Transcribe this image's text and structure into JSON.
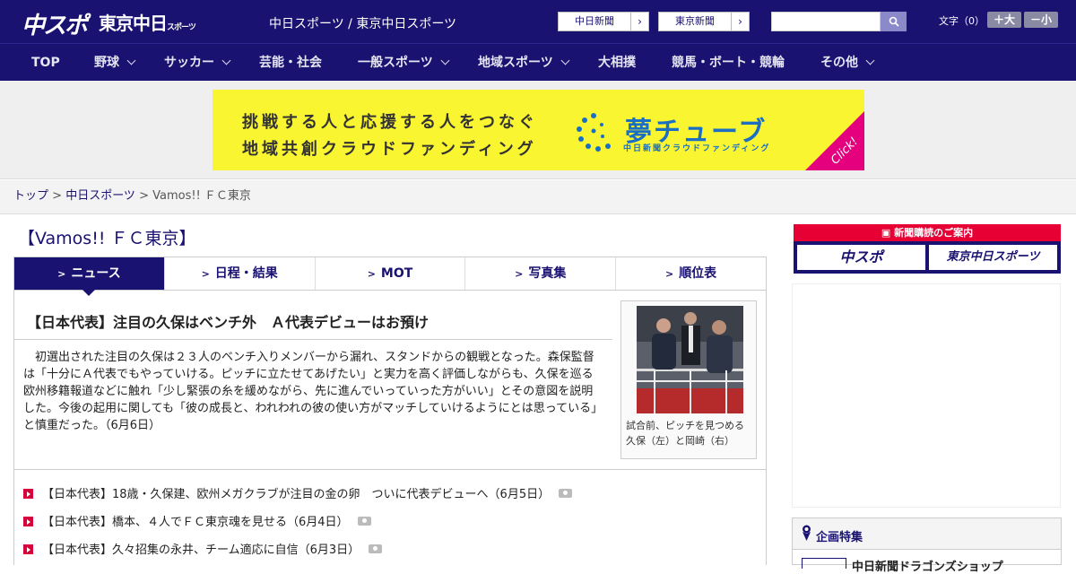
{
  "header": {
    "logo_chuspo": "中スポ",
    "logo_tokyo": "東京中日",
    "logo_tokyo_small": "スポーツ",
    "site_sub": "中日スポーツ / 東京中日スポーツ",
    "paper_buttons": [
      {
        "label": "中日新聞",
        "arrow": "›"
      },
      {
        "label": "東京新聞",
        "arrow": "›"
      }
    ],
    "search_placeholder": "",
    "text_size_label": "文字（0）",
    "text_size_up": "＋大",
    "text_size_down": "－小"
  },
  "nav": {
    "items": [
      {
        "label": "TOP",
        "has_dropdown": false
      },
      {
        "label": "野球",
        "has_dropdown": true
      },
      {
        "label": "サッカー",
        "has_dropdown": true
      },
      {
        "label": "芸能・社会",
        "has_dropdown": false
      },
      {
        "label": "一般スポーツ",
        "has_dropdown": true
      },
      {
        "label": "地域スポーツ",
        "has_dropdown": true
      },
      {
        "label": "大相撲",
        "has_dropdown": false
      },
      {
        "label": "競馬・ボート・競輪",
        "has_dropdown": false
      },
      {
        "label": "その他",
        "has_dropdown": true
      }
    ]
  },
  "banner": {
    "line1": "挑戦する人と応援する人をつなぐ",
    "line2": "地域共創クラウドファンディング",
    "brand": "夢チューブ",
    "brand_sub": "中日新聞クラウドファンディング",
    "click": "Click!",
    "colors": {
      "background": "#faf531",
      "brand": "#1a6fc4",
      "corner": "#e5007e"
    }
  },
  "breadcrumb": {
    "items": [
      "トップ",
      "中日スポーツ",
      "Vamos!! ＦＣ東京"
    ],
    "separator": " > "
  },
  "page": {
    "heading": "【Vamos!! ＦＣ東京】",
    "tabs": [
      {
        "label": "ニュース",
        "active": true
      },
      {
        "label": "日程・結果",
        "active": false
      },
      {
        "label": "MOT",
        "active": false
      },
      {
        "label": "写真集",
        "active": false
      },
      {
        "label": "順位表",
        "active": false
      }
    ]
  },
  "article": {
    "title": "【日本代表】注目の久保はベンチ外　Ａ代表デビューはお預け",
    "body": "初選出された注目の久保は２３人のベンチ入りメンバーから漏れ、スタンドからの観戦となった。森保監督は「十分にＡ代表でもやっていける。ピッチに立たせてあげたい」と実力を高く評価しながらも、久保を巡る欧州移籍報道などに触れ「少し緊張の糸を緩めながら、先に進んでいっていった方がいい」とその意図を説明した。今後の起用に関しても「彼の成長と、われわれの彼の使い方がマッチしていけるようにとは思っている」と慎重だった。（6月6日）",
    "photo_caption": "試合前、ピッチを見つめる久保（左）と岡崎（右）"
  },
  "related": [
    {
      "text": "【日本代表】18歳・久保建、欧州メガクラブが注目の金の卵　ついに代表デビューへ（6月5日）",
      "has_photo": true
    },
    {
      "text": "【日本代表】橋本、４人でＦＣ東京魂を見せる（6月4日）",
      "has_photo": true
    },
    {
      "text": "【日本代表】久々招集の永井、チーム適応に自信（6月3日）",
      "has_photo": true
    }
  ],
  "sidebar": {
    "subscription_head": "新聞購読のご案内",
    "logos": [
      "中スポ",
      "東京中日スポーツ"
    ],
    "feature_title": "企画特集",
    "feature_item": "中日新聞ドラゴンズショップ"
  },
  "colors": {
    "brand_navy": "#1a1270",
    "accent_red": "#d6003a"
  }
}
